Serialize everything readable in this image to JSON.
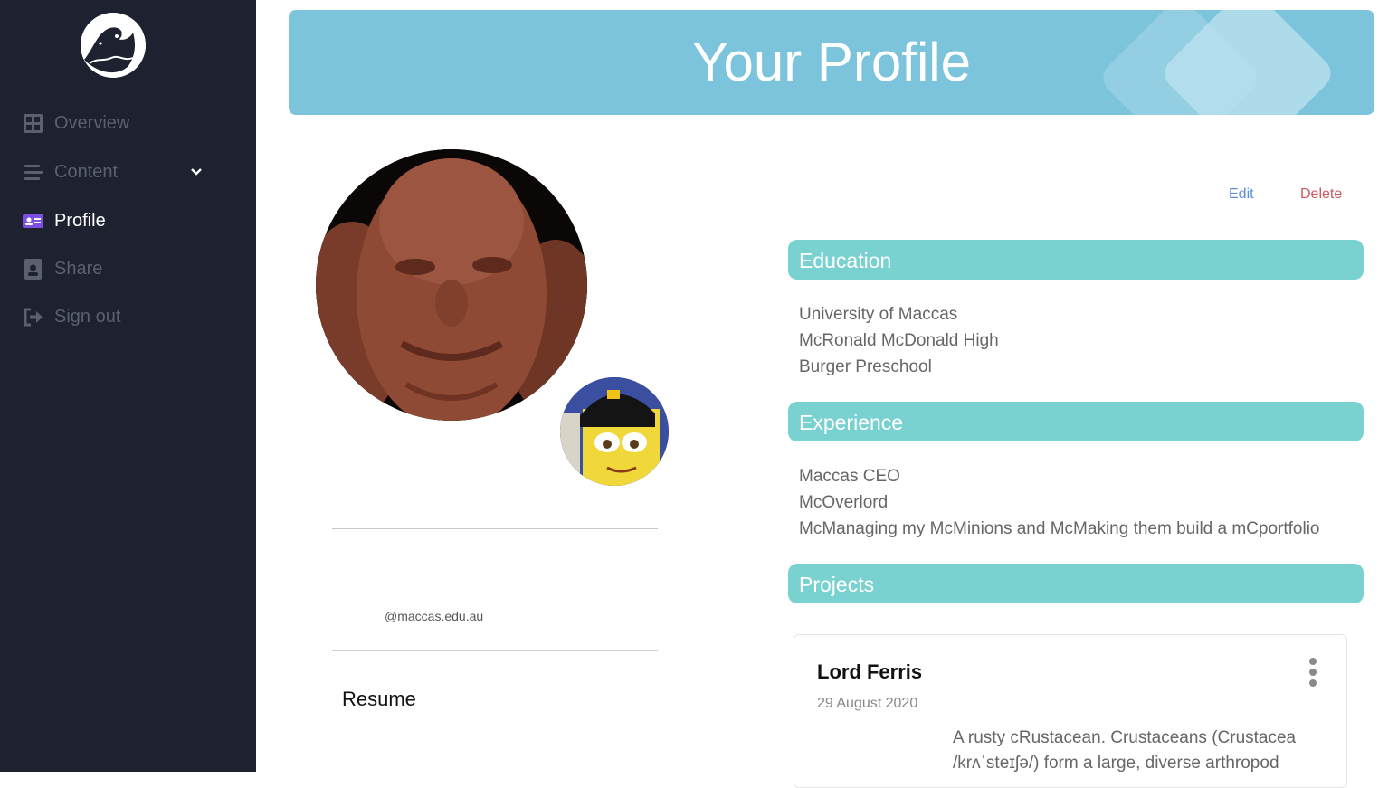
{
  "sidebar": {
    "items": [
      {
        "label": "Overview",
        "icon": "grid-icon"
      },
      {
        "label": "Content",
        "icon": "list-icon"
      },
      {
        "label": "Profile",
        "icon": "id-card-icon"
      },
      {
        "label": "Share",
        "icon": "badge-icon"
      },
      {
        "label": "Sign out",
        "icon": "sign-out-icon"
      }
    ],
    "active_index": 2
  },
  "header": {
    "title": "Your Profile"
  },
  "profile": {
    "name": ".",
    "email": "@maccas.edu.au",
    "resume_label": "Resume"
  },
  "actions": {
    "edit_label": "Edit",
    "delete_label": "Delete"
  },
  "education": {
    "heading": "Education",
    "items": [
      "University of Maccas",
      "McRonald McDonald High",
      "Burger Preschool"
    ]
  },
  "experience": {
    "heading": "Experience",
    "items": [
      "Maccas CEO",
      "McOverlord",
      "McManaging my McMinions and McMaking them build a mCportfolio"
    ]
  },
  "projects": {
    "heading": "Projects",
    "items": [
      {
        "title": "Lord Ferris",
        "date": "29 August 2020",
        "description": "A rusty cRustacean. Crustaceans (Crustacea /krʌˈsteɪʃə/) form a large, diverse arthropod"
      }
    ]
  },
  "colors": {
    "sidebar_bg": "#1d2130",
    "active_accent": "#7b4fe0",
    "banner_bg": "#7cc4dc",
    "section_bg": "#7ad2d0",
    "edit": "#5a8fd6",
    "delete": "#c9575d"
  }
}
